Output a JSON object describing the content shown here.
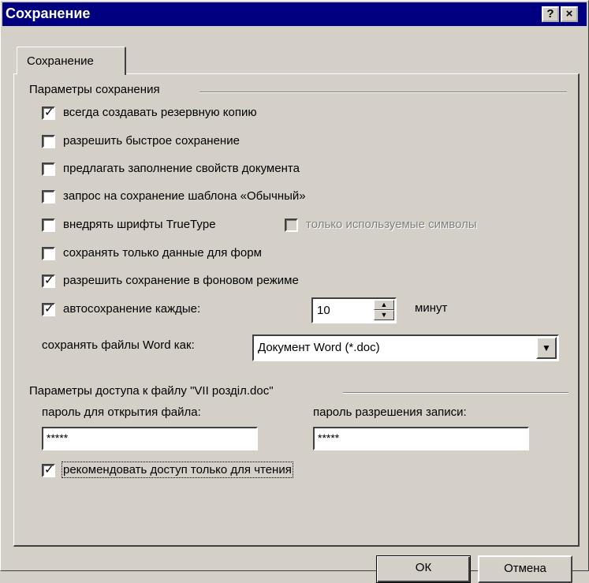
{
  "window": {
    "title": "Сохранение",
    "help_label": "?",
    "close_label": "×"
  },
  "tab": {
    "label": "Сохранение"
  },
  "save_options": {
    "group_title": "Параметры сохранения",
    "items": [
      {
        "label": "всегда создавать резервную копию",
        "checked": true
      },
      {
        "label": "разрешить быстрое сохранение",
        "checked": false
      },
      {
        "label": "предлагать заполнение свойств документа",
        "checked": false
      },
      {
        "label": "запрос на сохранение шаблона «Обычный»",
        "checked": false
      },
      {
        "label": "внедрять шрифты TrueType",
        "checked": false
      },
      {
        "label": "сохранять только данные для форм",
        "checked": false
      },
      {
        "label": "разрешить сохранение в фоновом режиме",
        "checked": true
      },
      {
        "label": "автосохранение каждые:",
        "checked": true
      }
    ],
    "embed_subset": {
      "label": "только используемые символы",
      "checked": false,
      "disabled": true
    },
    "autosave_value": "10",
    "autosave_unit": "минут",
    "save_as_label": "сохранять файлы Word как:",
    "save_as_value": "Документ Word (*.doc)"
  },
  "access": {
    "group_title": "Параметры доступа к файлу \"VII розділ.doc\"",
    "open_password_label": "пароль для открытия файла:",
    "open_password_value": "*****",
    "write_password_label": "пароль разрешения записи:",
    "write_password_value": "*****",
    "readonly": {
      "label": "рекомендовать доступ только для чтения",
      "checked": true
    }
  },
  "buttons": {
    "ok": "ОК",
    "cancel": "Отмена"
  },
  "check_glyph": "✓",
  "icons": {
    "spin_up": "up-arrow",
    "spin_down": "down-arrow",
    "dropdown": "down-arrow"
  }
}
